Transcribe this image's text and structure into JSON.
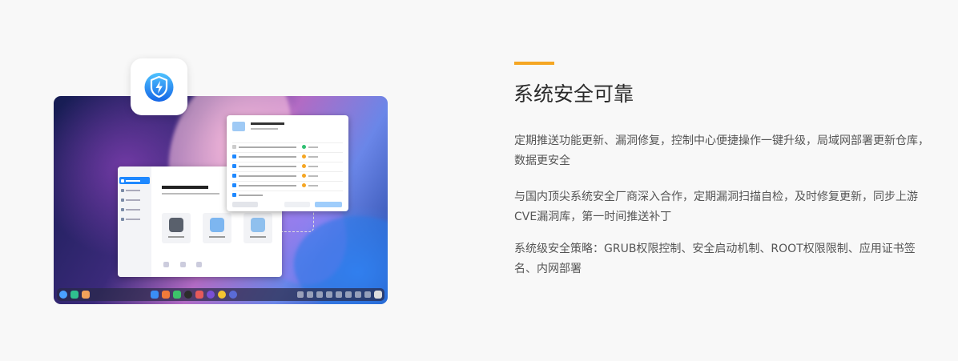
{
  "feature": {
    "title": "系统安全可靠",
    "paragraphs": [
      "定期推送功能更新、漏洞修复，控制中心便捷操作一键升级，局域网部署更新仓库，数据更安全",
      "与国内顶尖系统安全厂商深入合作，定期漏洞扫描自检，及时修复更新，同步上游CVE漏洞库，第一时间推送补丁",
      "系统级安全策略：GRUB权限控制、安全启动机制、ROOT权限限制、应用证书签名、内网部署"
    ]
  },
  "colors": {
    "accent": "#f5a623",
    "security_blue": "#1e88ff"
  },
  "icons": {
    "app": "shield-lightning-icon"
  }
}
